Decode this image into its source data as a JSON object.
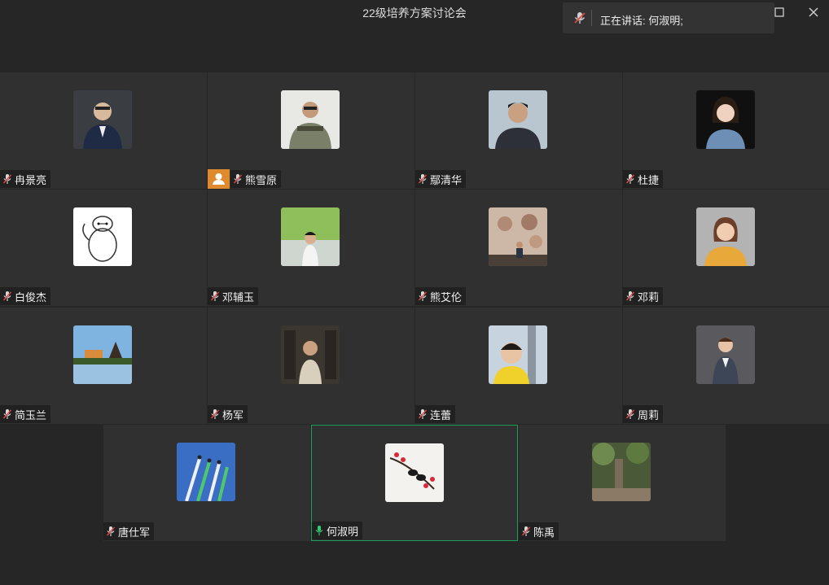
{
  "window": {
    "title": "22级培养方案讨论会",
    "speaking_label": "正在讲话: 何淑明;",
    "maximize_icon": "maximize-icon",
    "close_icon": "close-icon"
  },
  "participants": [
    {
      "name": "冉景亮",
      "mic": "muted"
    },
    {
      "name": "熊雪原",
      "mic": "muted",
      "host": true
    },
    {
      "name": "鄢清华",
      "mic": "muted"
    },
    {
      "name": "杜捷",
      "mic": "muted"
    },
    {
      "name": "白俊杰",
      "mic": "muted"
    },
    {
      "name": "邓辅玉",
      "mic": "muted"
    },
    {
      "name": "熊艾伦",
      "mic": "muted"
    },
    {
      "name": "邓莉",
      "mic": "muted"
    },
    {
      "name": "简玉兰",
      "mic": "muted"
    },
    {
      "name": "杨军",
      "mic": "muted"
    },
    {
      "name": "连蕾",
      "mic": "muted"
    },
    {
      "name": "周莉",
      "mic": "muted"
    },
    {
      "name": "唐仕军",
      "mic": "muted"
    },
    {
      "name": "何淑明",
      "mic": "active",
      "speaking": true
    },
    {
      "name": "陈禹",
      "mic": "muted"
    }
  ],
  "colors": {
    "background": "#262626",
    "tile": "#303030",
    "active_border": "#1f9e5b",
    "host_badge": "#e08a2e",
    "mic_muted": "#d9d9d9",
    "mic_active": "#2ecc71"
  }
}
